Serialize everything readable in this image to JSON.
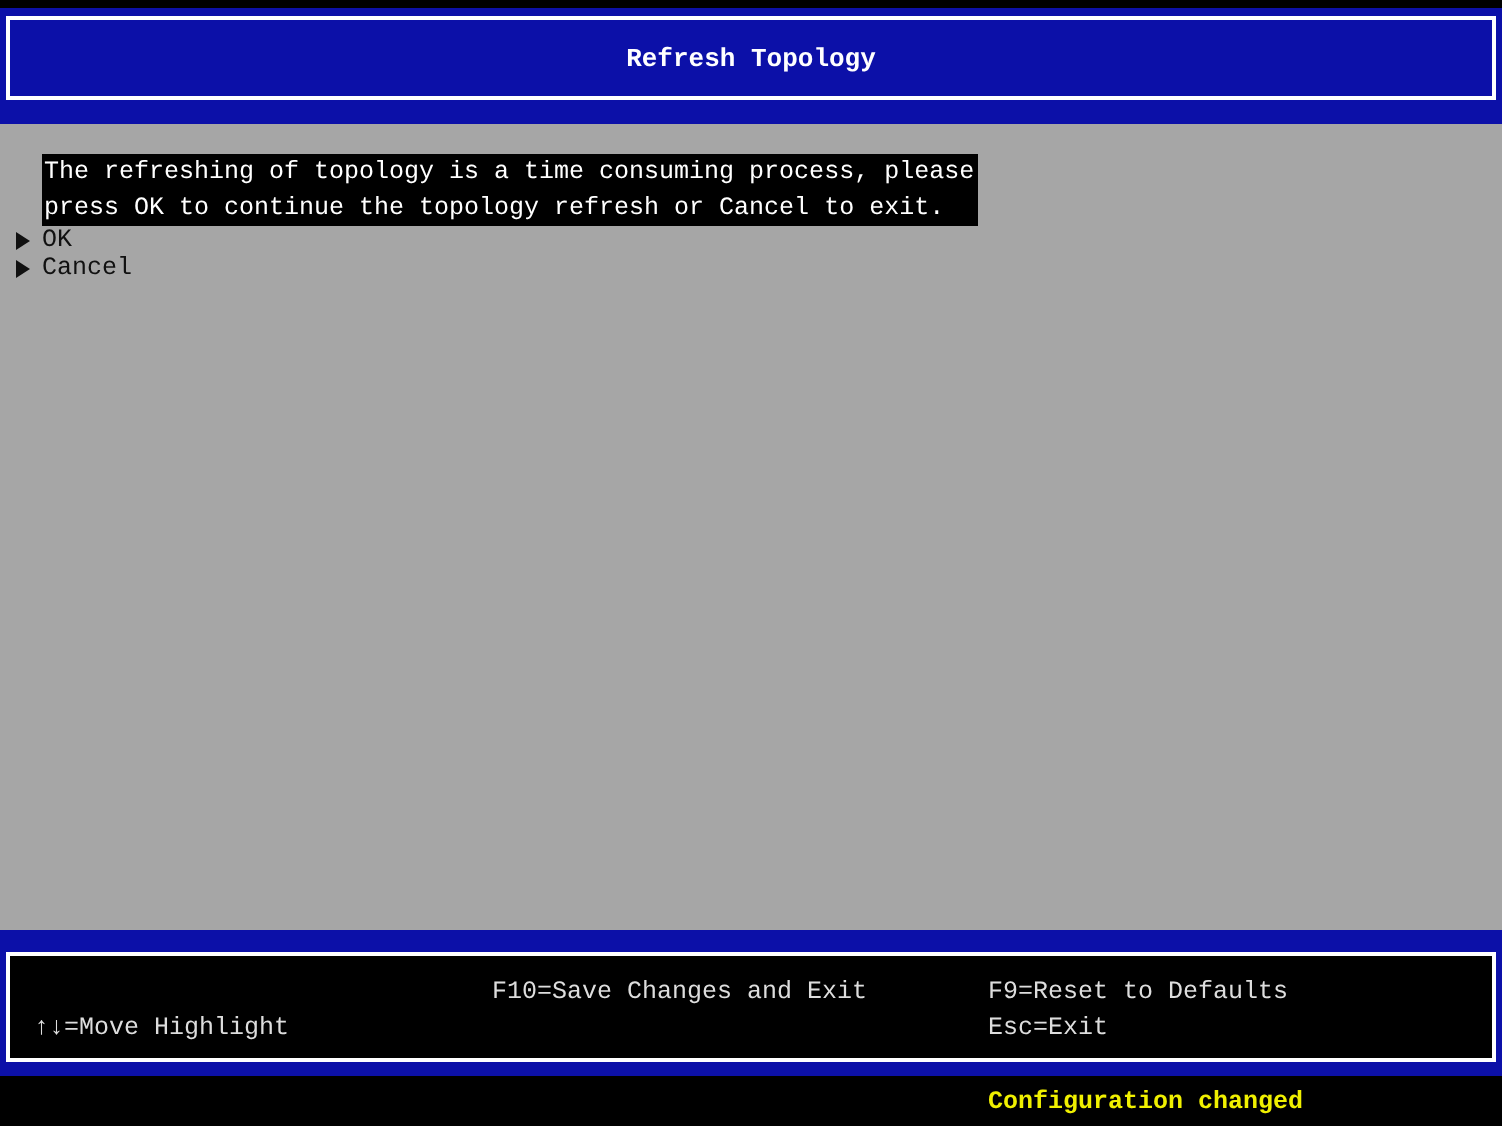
{
  "window": {
    "title": "Refresh Topology"
  },
  "message": "The refreshing of topology is a time consuming process, please\npress OK to continue the topology refresh or Cancel to exit.",
  "options": [
    {
      "label": "OK"
    },
    {
      "label": "Cancel"
    }
  ],
  "help_bar": {
    "left": [
      "↑↓=Move Highlight"
    ],
    "middle": [
      "F10=Save Changes and Exit"
    ],
    "right": [
      "F9=Reset to Defaults",
      "Esc=Exit"
    ]
  },
  "status_bar": "Configuration changed"
}
